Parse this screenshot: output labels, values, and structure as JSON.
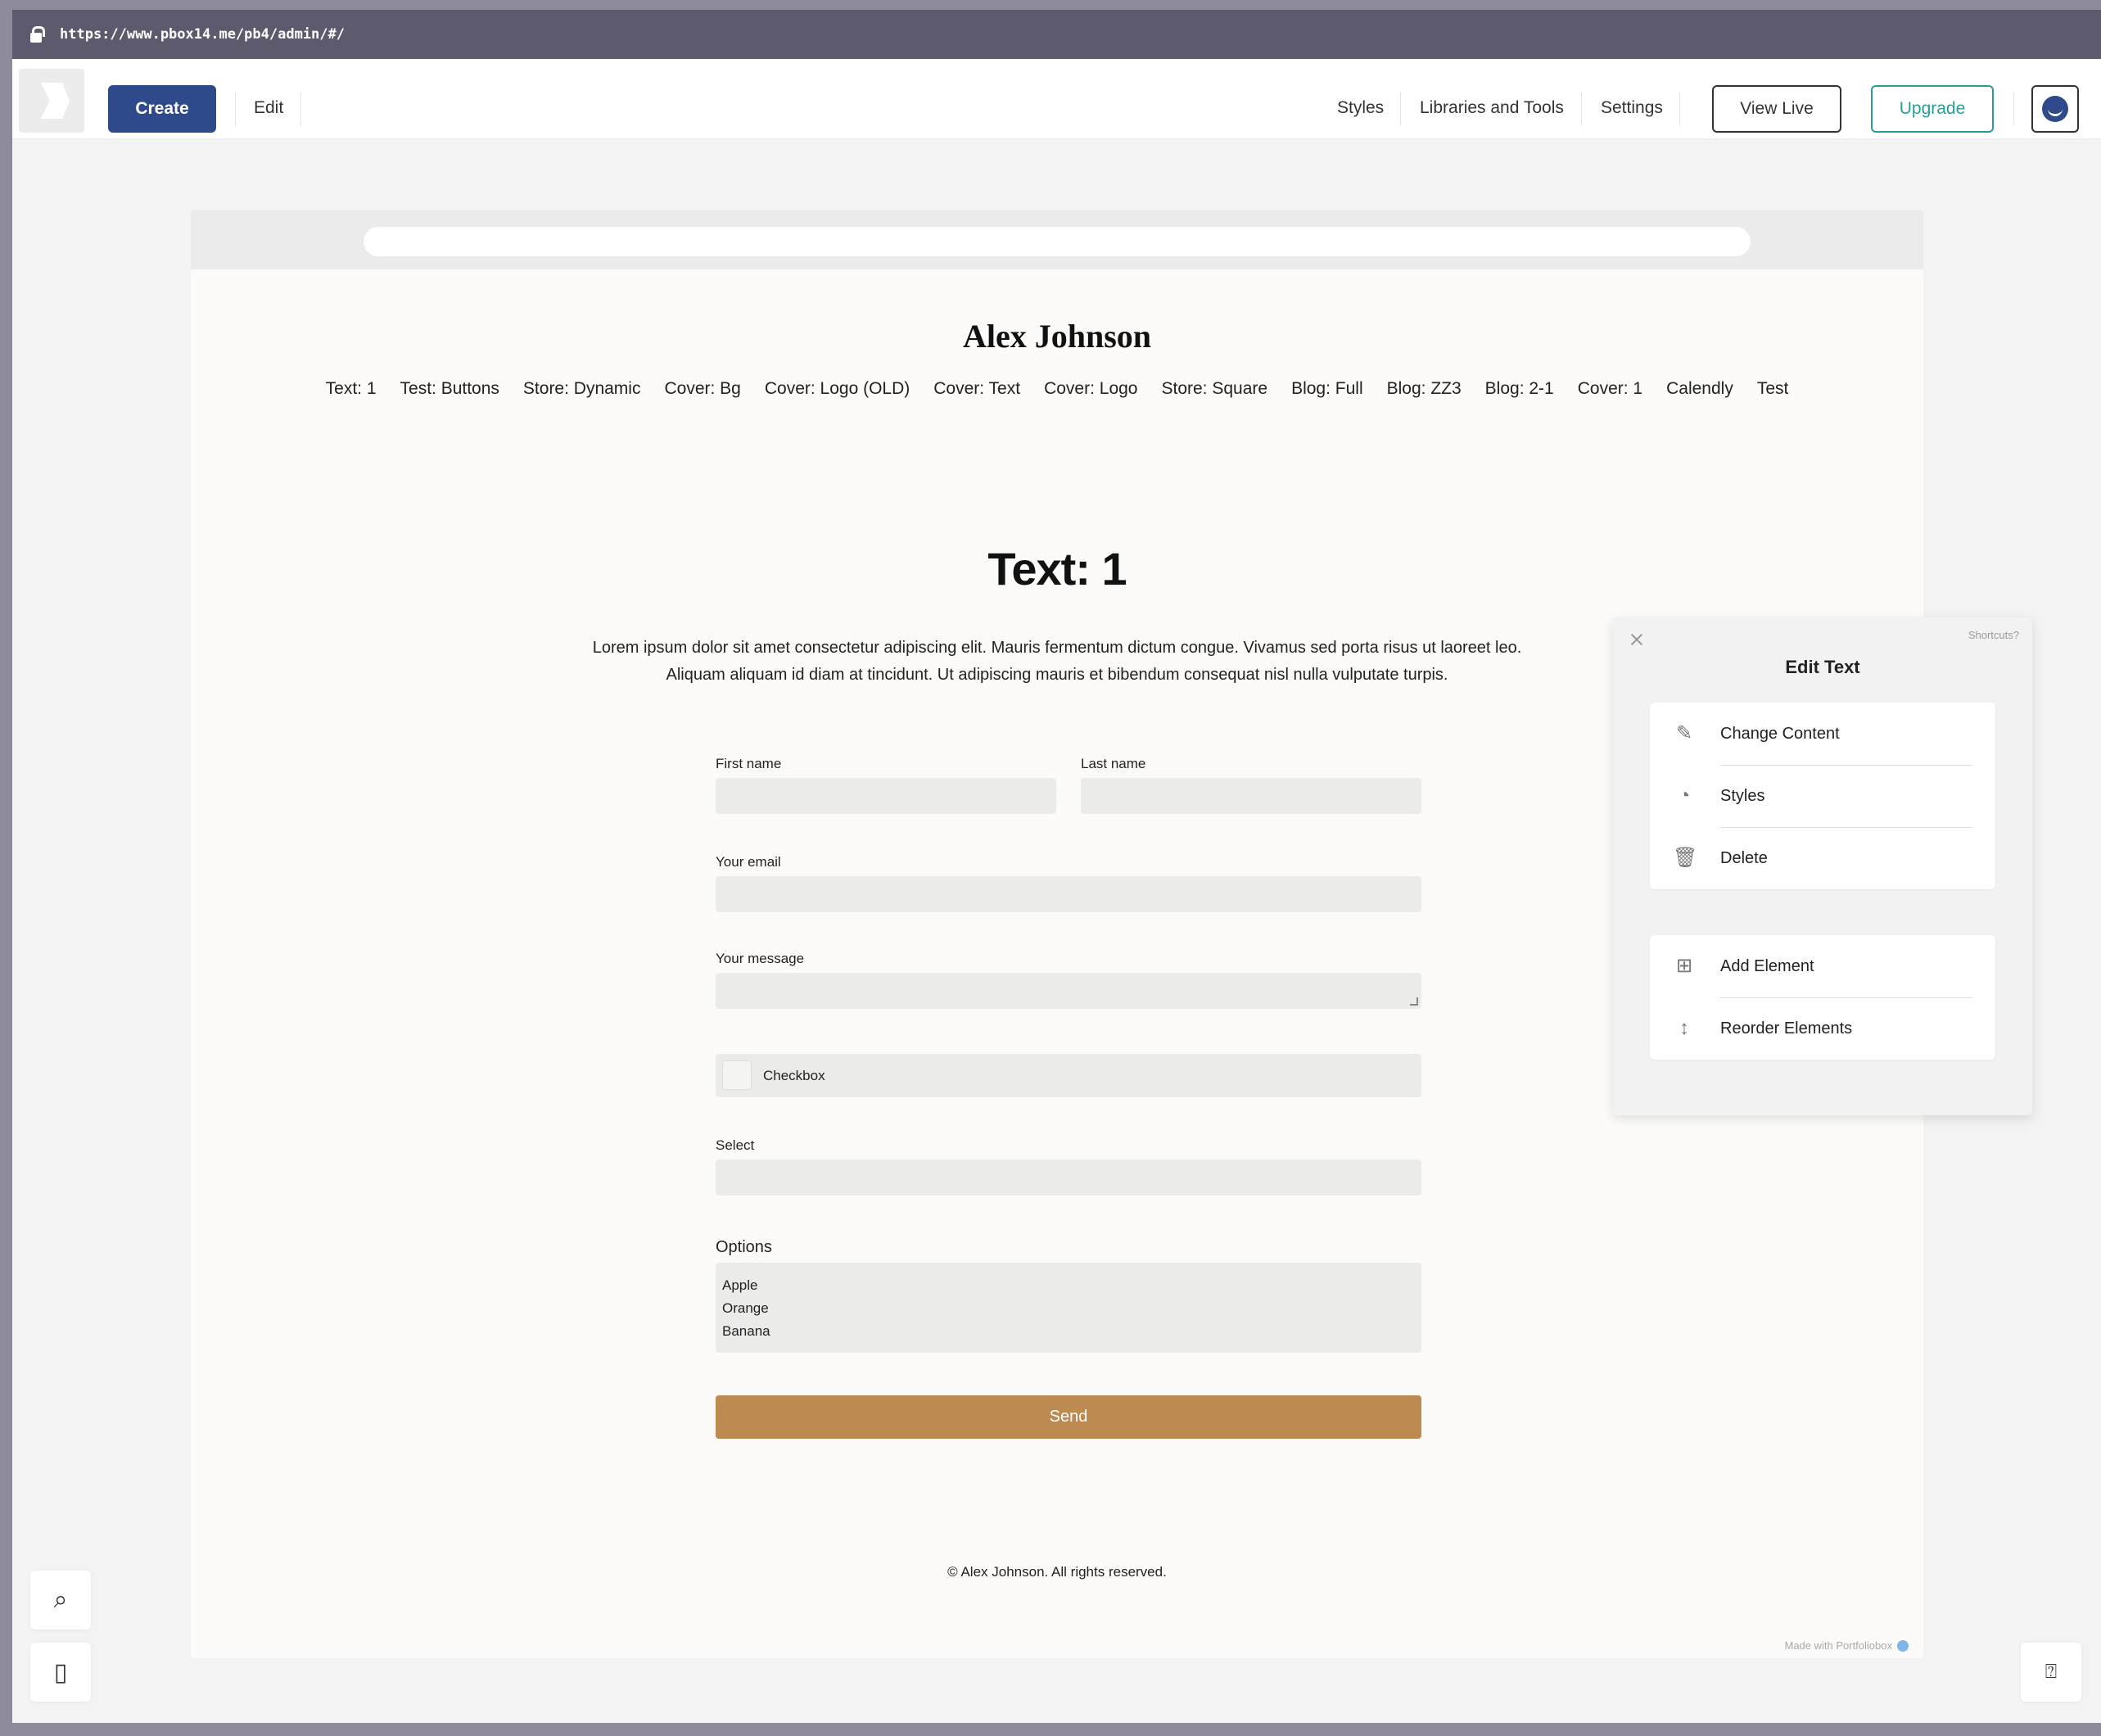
{
  "browser": {
    "url": "https://www.pbox14.me/pb4/admin/#/"
  },
  "toolbar": {
    "create_label": "Create",
    "edit_label": "Edit",
    "nav": [
      "Styles",
      "Libraries and Tools",
      "Settings"
    ],
    "view_live_label": "View Live",
    "upgrade_label": "Upgrade"
  },
  "site": {
    "title": "Alex Johnson",
    "nav": [
      "Text: 1",
      "Test: Buttons",
      "Store: Dynamic",
      "Cover: Bg",
      "Cover: Logo (OLD)",
      "Cover: Text",
      "Cover: Logo",
      "Store: Square",
      "Blog: Full",
      "Blog: ZZ3",
      "Blog: 2-1",
      "Cover: 1",
      "Calendly",
      "Test"
    ],
    "section_title": "Text: 1",
    "intro_line1": "Lorem ipsum dolor sit amet consectetur adipiscing elit. Mauris fermentum dictum congue. Vivamus sed porta risus ut laoreet leo.",
    "intro_line2": "Aliquam aliquam id diam at tincidunt. Ut adipiscing mauris et bibendum consequat nisl nulla vulputate turpis.",
    "footer": "© Alex Johnson. All rights reserved.",
    "made_with": "Made with Portfoliobox"
  },
  "form": {
    "first_name_label": "First name",
    "last_name_label": "Last name",
    "email_label": "Your email",
    "message_label": "Your message",
    "checkbox_label": "Checkbox",
    "select_label": "Select",
    "options_label": "Options",
    "options": [
      "Apple",
      "Orange",
      "Banana"
    ],
    "send_label": "Send"
  },
  "edit_panel": {
    "title": "Edit Text",
    "shortcuts": "Shortcuts?",
    "group1": [
      "Change Content",
      "Styles",
      "Delete"
    ],
    "group2": [
      "Add Element",
      "Reorder Elements"
    ]
  },
  "colors": {
    "primary": "#2f4a8a",
    "upgrade": "#2a9d95",
    "send": "#bd8a52"
  }
}
